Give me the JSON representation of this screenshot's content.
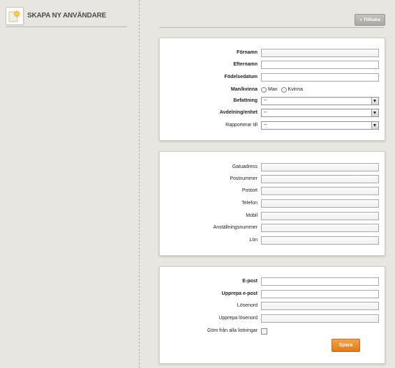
{
  "sidebar": {
    "title": "SKAPA NY ANVÄNDARE",
    "icon": "new-user-star-icon"
  },
  "toolbar": {
    "back_label": "« Tillbaka"
  },
  "personal": {
    "first_name_label": "Förnamn",
    "last_name_label": "Efternamn",
    "birthdate_label": "Födelsedatum",
    "gender_label": "Man/kvinna",
    "gender_options": [
      "Man",
      "Kvinna"
    ],
    "position_label": "Befattning",
    "position_value": "--",
    "department_label": "Avdelning/enhet",
    "department_value": "--",
    "reports_to_label": "Rapporterar till",
    "reports_to_value": "--"
  },
  "contact": {
    "street_label": "Gatuadress",
    "postal_code_label": "Postnummer",
    "city_label": "Postort",
    "phone_label": "Telefon",
    "mobile_label": "Mobil",
    "employee_number_label": "Anställningsnummer",
    "salary_label": "Lön"
  },
  "account": {
    "email_label": "E-post",
    "email_repeat_label": "Upprepa e-post",
    "password_label": "Lösenord",
    "password_repeat_label": "Upprepa lösenord",
    "hide_label": "Göm från alla listningar",
    "save_label": "Spara"
  },
  "colors": {
    "background": "#e8e6e1",
    "accent": "#e8841d",
    "panel": "#ffffff"
  }
}
